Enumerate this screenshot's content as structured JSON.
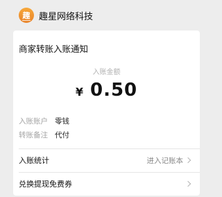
{
  "header": {
    "logo_glyph": "趣",
    "brand_name": "趣星网络科技"
  },
  "notice": {
    "title": "商家转账入账通知",
    "amount_label": "入账金额",
    "currency": "¥",
    "amount": "0.50",
    "details": [
      {
        "key": "入账账户",
        "value": "零钱"
      },
      {
        "key": "转账备注",
        "value": "代付"
      }
    ]
  },
  "actions": {
    "stats_label": "入账统计",
    "stats_action": "进入记账本",
    "coupon_label": "兑换提现免费券"
  },
  "colors": {
    "accent": "#f0962f",
    "background": "#ededed"
  }
}
